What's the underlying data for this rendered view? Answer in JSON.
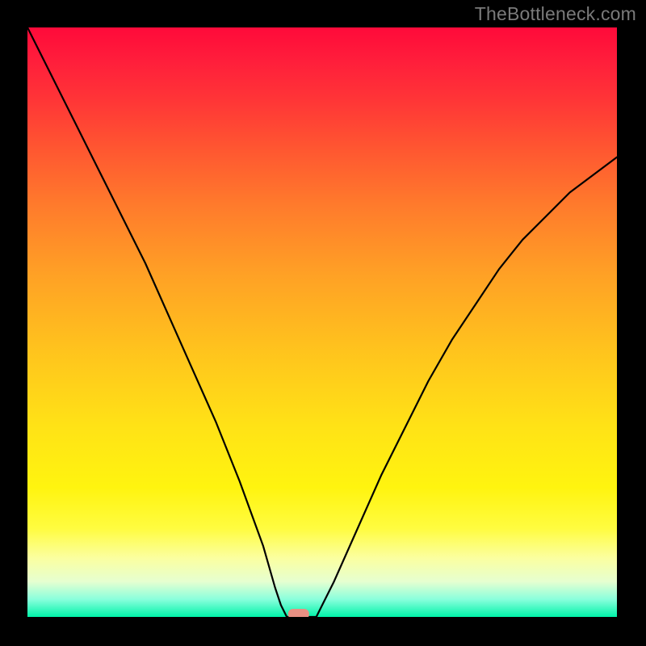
{
  "watermark": "TheBottleneck.com",
  "chart_data": {
    "type": "line",
    "title": "",
    "xlabel": "",
    "ylabel": "",
    "xlim": [
      0,
      100
    ],
    "ylim": [
      0,
      100
    ],
    "grid": false,
    "legend": false,
    "background_gradient": {
      "direction": "vertical",
      "stops": [
        {
          "pos": 0,
          "color": "#ff0a3a",
          "meaning": "high"
        },
        {
          "pos": 50,
          "color": "#ffc41d",
          "meaning": "mid"
        },
        {
          "pos": 100,
          "color": "#00f3a9",
          "meaning": "low"
        }
      ]
    },
    "series": [
      {
        "name": "bottleneck-curve",
        "x": [
          0,
          4,
          8,
          12,
          16,
          20,
          24,
          28,
          32,
          36,
          40,
          42,
          43,
          44,
          46,
          49,
          50,
          52,
          56,
          60,
          64,
          68,
          72,
          76,
          80,
          84,
          88,
          92,
          96,
          100
        ],
        "y": [
          100,
          92,
          84,
          76,
          68,
          60,
          51,
          42,
          33,
          23,
          12,
          5,
          2,
          0,
          0,
          0,
          2,
          6,
          15,
          24,
          32,
          40,
          47,
          53,
          59,
          64,
          68,
          72,
          75,
          78
        ]
      }
    ],
    "marker": {
      "name": "optimal-point",
      "x": 46,
      "y": 0,
      "shape": "rounded-rect",
      "color": "#e89083"
    }
  }
}
